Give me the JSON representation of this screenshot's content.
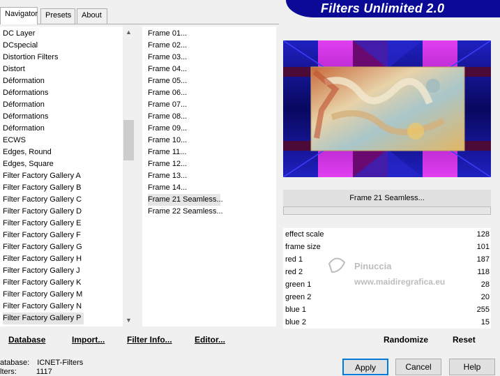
{
  "tabs": [
    "Navigator",
    "Presets",
    "About"
  ],
  "banner": "Filters Unlimited 2.0",
  "categories": [
    "DC Layer",
    "DCspecial",
    "Distortion Filters",
    "Distort",
    "Déformation",
    "Déformations",
    "Déformation",
    "Déformations",
    "Déformation",
    "ECWS",
    "Edges, Round",
    "Edges, Square",
    "Filter Factory Gallery A",
    "Filter Factory Gallery B",
    "Filter Factory Gallery C",
    "Filter Factory Gallery D",
    "Filter Factory Gallery E",
    "Filter Factory Gallery F",
    "Filter Factory Gallery G",
    "Filter Factory Gallery H",
    "Filter Factory Gallery J",
    "Filter Factory Gallery K",
    "Filter Factory Gallery M",
    "Filter Factory Gallery N",
    "Filter Factory Gallery P"
  ],
  "filters": [
    "Frame 01...",
    "Frame 02...",
    "Frame 03...",
    "Frame 04...",
    "Frame 05...",
    "Frame 06...",
    "Frame 07...",
    "Frame 08...",
    "Frame 09...",
    "Frame 10...",
    "Frame 11...",
    "Frame 12...",
    "Frame 13...",
    "Frame 14...",
    "Frame 21 Seamless...",
    "Frame 22 Seamless..."
  ],
  "selected_filter": "Frame 21 Seamless...",
  "params": [
    {
      "name": "effect scale",
      "value": "128"
    },
    {
      "name": "frame size",
      "value": "101"
    },
    {
      "name": "red 1",
      "value": "187"
    },
    {
      "name": "red 2",
      "value": "118"
    },
    {
      "name": "green 1",
      "value": "28"
    },
    {
      "name": "green 2",
      "value": "20"
    },
    {
      "name": "blue 1",
      "value": "255"
    },
    {
      "name": "blue 2",
      "value": "15"
    }
  ],
  "watermark": {
    "line1": "Pinuccia",
    "line2": "www.maidiregrafica.eu"
  },
  "buttons": {
    "database": "Database",
    "import": "Import...",
    "filter_info": "Filter Info...",
    "editor": "Editor...",
    "randomize": "Randomize",
    "reset": "Reset",
    "apply": "Apply",
    "cancel": "Cancel",
    "help": "Help"
  },
  "status": {
    "database_label": "atabase:",
    "database_value": "ICNET-Filters",
    "filters_label": "lters:",
    "filters_value": "1117"
  },
  "colors": {
    "banner": "#0a0a96",
    "frame_magenta": "#c020d8",
    "frame_blue": "#1010a0",
    "frame_darkred": "#5a0820",
    "apply_border": "#0078d7"
  }
}
